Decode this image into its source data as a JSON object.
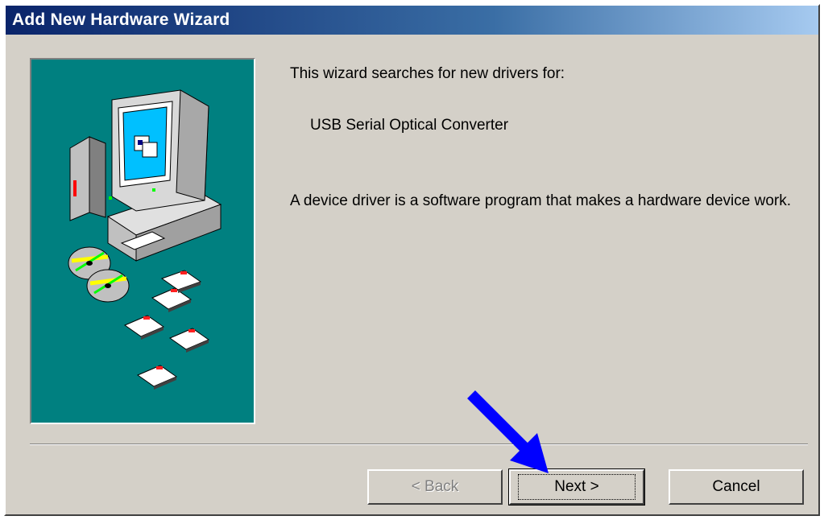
{
  "window": {
    "title": "Add New Hardware Wizard"
  },
  "content": {
    "intro": "This wizard searches for new drivers for:",
    "device_name": "USB Serial Optical Converter",
    "description": "A device driver is a software program that makes a hardware device work."
  },
  "buttons": {
    "back": "< Back",
    "next": "Next >",
    "cancel": "Cancel"
  },
  "icons": {
    "illustration": "computer-with-disks-icon",
    "annotation": "blue-arrow-pointer"
  },
  "colors": {
    "title_start": "#0a246a",
    "title_end": "#a6caf0",
    "panel": "#008080",
    "face": "#d4d0c8",
    "arrow": "#0000ff"
  }
}
